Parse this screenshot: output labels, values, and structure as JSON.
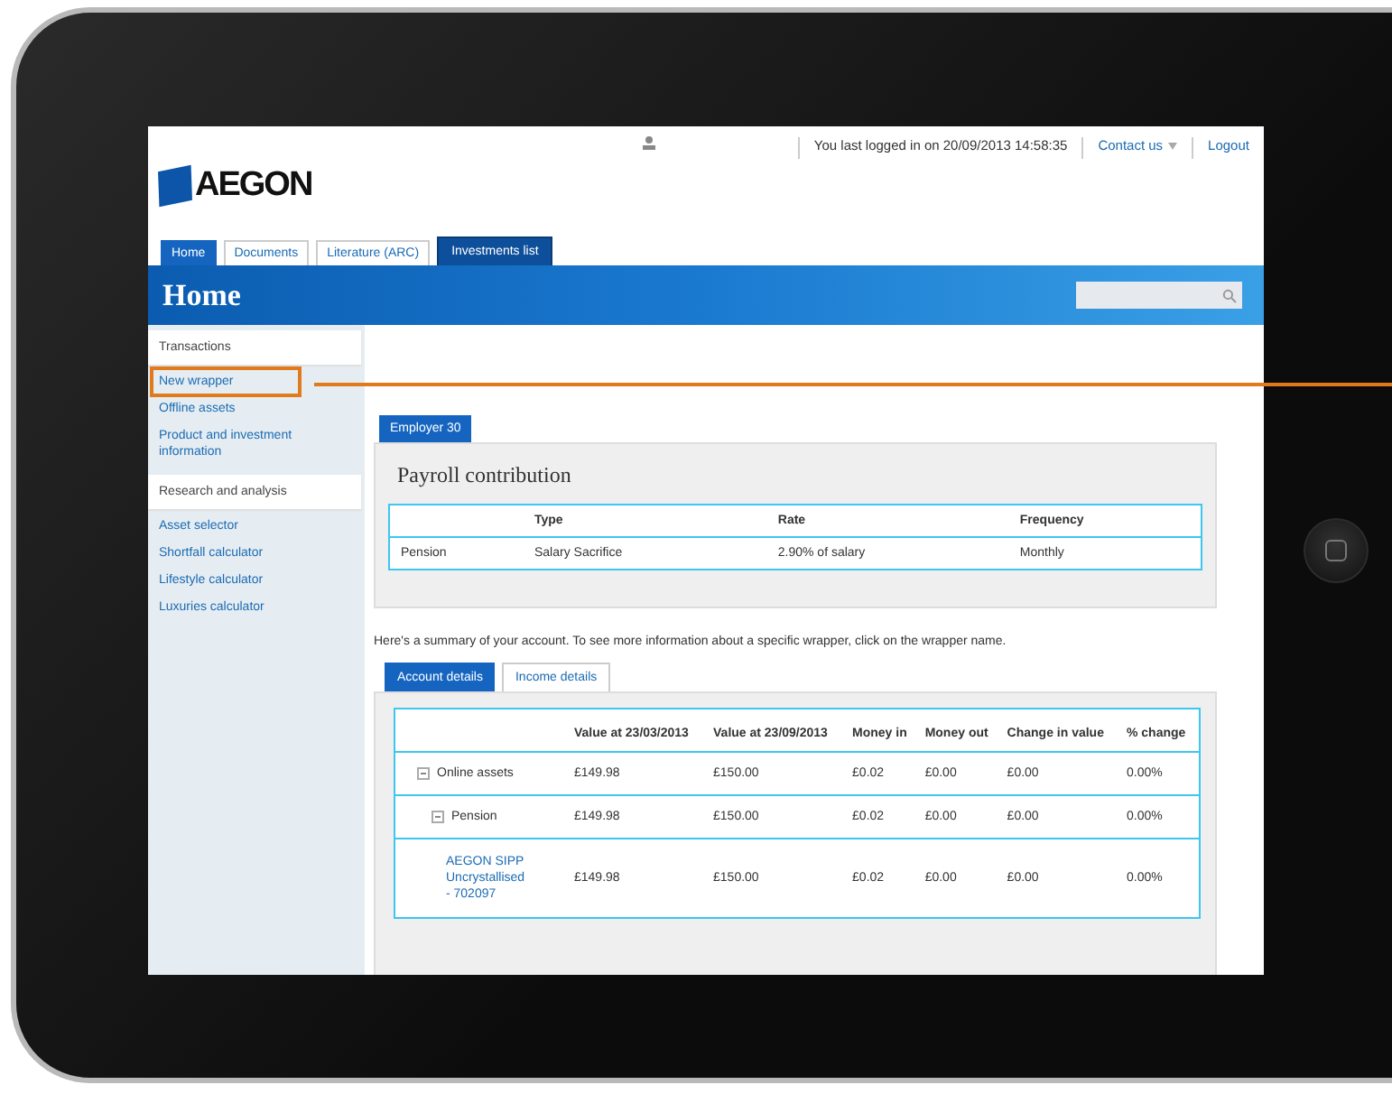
{
  "header": {
    "logo": "AEGON",
    "last_login": "You last logged in on 20/09/2013 14:58:35",
    "links": [
      {
        "label": "Contact us",
        "dropdown": true
      },
      {
        "label": "Logout",
        "dropdown": false
      }
    ]
  },
  "nav_tabs": [
    {
      "label": "Home",
      "selected": true,
      "highlighted": false
    },
    {
      "label": "Documents",
      "selected": false,
      "highlighted": false
    },
    {
      "label": "Literature (ARC)",
      "selected": false,
      "highlighted": false
    },
    {
      "label": "Investments list",
      "selected": false,
      "highlighted": true
    }
  ],
  "banner": {
    "title": "Home"
  },
  "sidebar": {
    "sections": [
      {
        "heading": "Transactions",
        "items": [
          {
            "label": "New wrapper",
            "callout": true
          },
          {
            "label": "Offline assets",
            "callout": false
          },
          {
            "label": "Product and investment information",
            "callout": false
          }
        ]
      },
      {
        "heading": "Research and analysis",
        "items": [
          {
            "label": "Asset selector",
            "callout": false
          },
          {
            "label": "Shortfall calculator",
            "callout": false
          },
          {
            "label": "Lifestyle calculator",
            "callout": false
          },
          {
            "label": "Luxuries calculator",
            "callout": false
          }
        ]
      }
    ]
  },
  "employer_tab": "Employer 30",
  "payroll": {
    "title": "Payroll contribution",
    "columns": [
      "",
      "Type",
      "Rate",
      "Frequency"
    ],
    "rows": [
      [
        "Pension",
        "Salary Sacrifice",
        "2.90% of salary",
        "Monthly"
      ]
    ]
  },
  "summary_text": "Here's a summary of your account. To see more information about a specific wrapper, click on the wrapper name.",
  "account_tabs": [
    {
      "label": "Account details",
      "selected": true
    },
    {
      "label": "Income details",
      "selected": false
    }
  ],
  "accounts": {
    "columns": [
      "Value at 23/03/2013",
      "Value at 23/09/2013",
      "Money in",
      "Money out",
      "Change in value",
      "% change"
    ],
    "rows": [
      {
        "name": "Online assets",
        "kind": "group",
        "expanded": true,
        "values": [
          "£149.98",
          "£150.00",
          "£0.02",
          "£0.00",
          "£0.00",
          "0.00%"
        ],
        "children": [
          {
            "name": "Pension",
            "kind": "group",
            "expanded": true,
            "values": [
              "£149.98",
              "£150.00",
              "£0.02",
              "£0.00",
              "£0.00",
              "0.00%"
            ],
            "children": [
              {
                "name": "AEGON SIPP Uncrystallised - 702097",
                "kind": "wrapper",
                "values": [
                  "£149.98",
                  "£150.00",
                  "£0.02",
                  "£0.00",
                  "£0.00",
                  "0.00%"
                ]
              }
            ]
          }
        ]
      }
    ]
  }
}
